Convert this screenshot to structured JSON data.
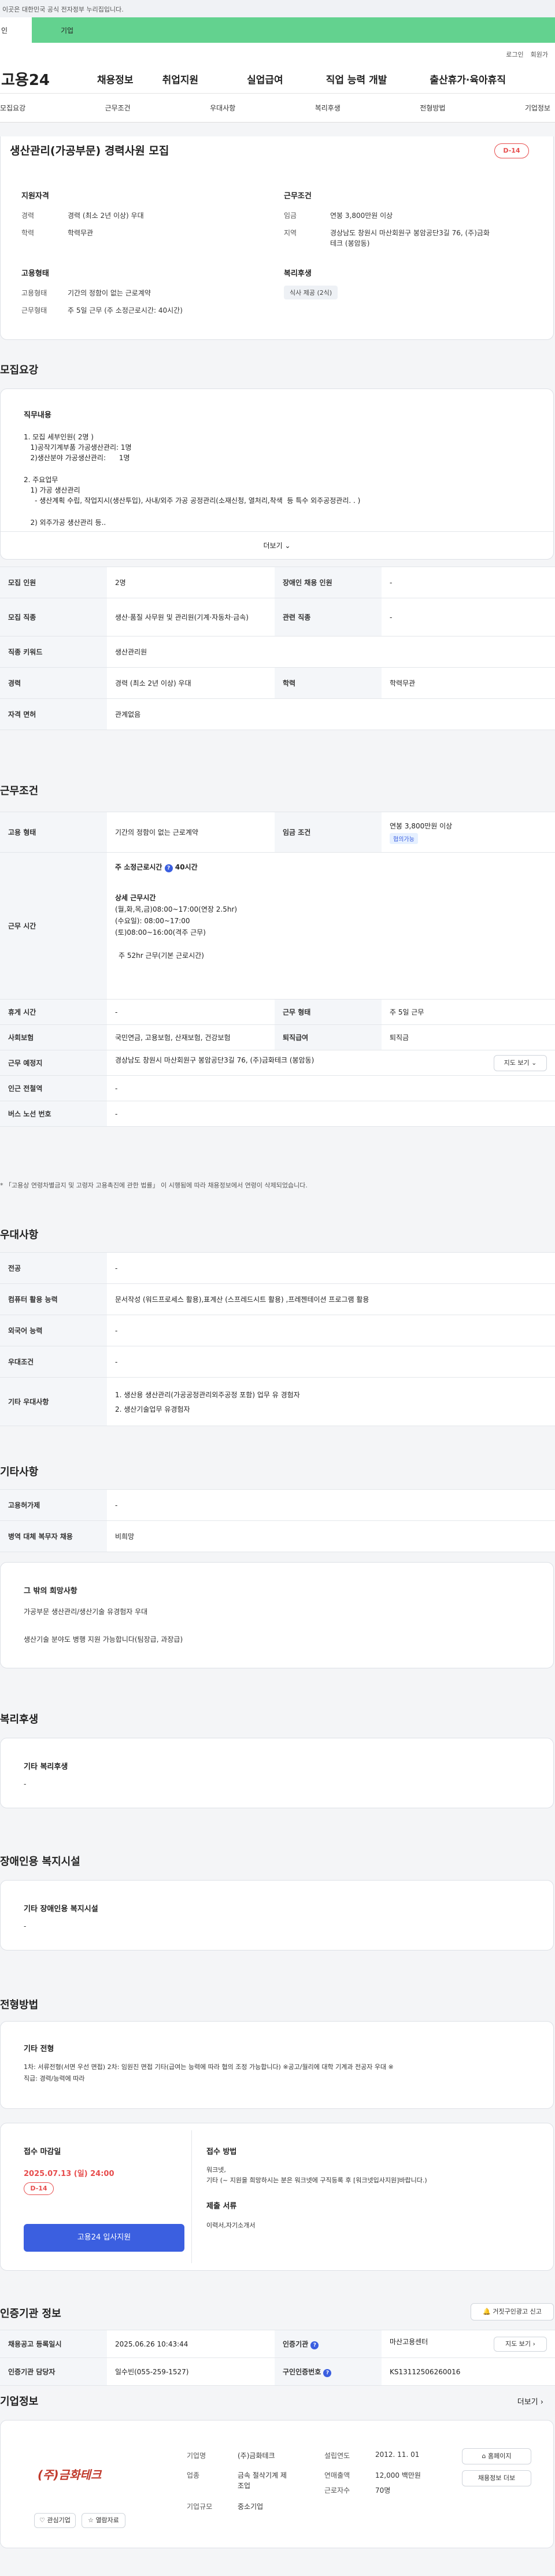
{
  "gov_banner": "이 누리집은 대한민국 공식 전자정부 누리집입니다.",
  "gov_banner_visible": "이곳은 대한민국 공식 전자정부 누리집입니다.",
  "top_tabs": [
    "인",
    "기업"
  ],
  "util": [
    "로그인",
    "회원가"
  ],
  "logo": "고용24",
  "gnb": [
    "채용정보",
    "취업지원",
    "실업급여",
    "직업 능력 개발",
    "출산휴가·육아휴직"
  ],
  "subnav": [
    "모집요강",
    "근무조건",
    "우대사항",
    "복리후생",
    "전형방법",
    "기업정보"
  ],
  "job": {
    "title": "생산관리(가공부문) 경력사원 모집",
    "dday": "D-14",
    "qual_title": "지원자격",
    "career_l": "경력",
    "career_v": "경력 (최소 2년 이상) 우대",
    "edu_l": "학력",
    "edu_v": "학력무관",
    "cond_title": "근무조건",
    "wage_l": "임금",
    "wage_v": "연봉 3,800만원 이상",
    "loc_l": "지역",
    "loc_v1": "경상남도 창원시 마산회원구 봉암공단3길 76, (주)금화",
    "loc_v2": "테크 (봉암동)",
    "emp_title": "고용형태",
    "emp_l": "고용형태",
    "emp_v": "기간의 정함이 없는 근로계약",
    "work_l": "근무형태",
    "work_v": "주 5일 근무 (주 소정근로시간: 40시간)",
    "welfare_title": "복리후생",
    "welfare_tag": "식사 제공 (2식)"
  },
  "recruit": {
    "section": "모집요강",
    "content_title": "직무내용",
    "lines": [
      "1. 모집 세부인원( 2명 )",
      "   1)공작기계부품 가공생산관리: 1명",
      "   2)생산분야 가공생산관리:      1명",
      "",
      "2. 주요업무",
      "   1) 가공 생산관리",
      "     - 생산계획 수립, 작업지시(생산투입), 사내/외주 가공 공정관리(소재신청, 열처리,착색  등 특수 외주공정관리. . )",
      "",
      "   2) 외주가공 생산관리 등.."
    ],
    "more": "더보기",
    "rows": [
      {
        "h1": "모집 인원",
        "v1": "2명",
        "h2": "장애인 채용 인원",
        "v2": "-"
      },
      {
        "h1": "모집 직종",
        "v1": "생산·품질 사무원 및 관리원(기계·자동차·금속)",
        "h2": "관련 직종",
        "v2": "-"
      },
      {
        "h1": "직종 키워드",
        "v1": "생산관리원"
      },
      {
        "h1": "경력",
        "v1": "경력 (최소 2년 이상) 우대",
        "h2": "학력",
        "v2": "학력무관"
      },
      {
        "h1": "자격 면허",
        "v1": "관계없음"
      }
    ]
  },
  "workcond": {
    "section": "근무조건",
    "emp_h": "고용 형태",
    "emp_v": "기간의 정함이 없는 근로계약",
    "wage_h": "임금 조건",
    "wage_v": "연봉 3,800만원 이상",
    "wage_tag": "협의가능",
    "time_h": "근무 시간",
    "time_lines": [
      "주 소정근로시간",
      "40시간",
      "상세 근무시간",
      "(월,화,목,금)08:00~17:00(연장 2.5hr)",
      "(수요일): 08:00~17:00",
      "(토)08:00~16:00(격주 근무)",
      "주 52hr 근무(기본 근로시간)"
    ],
    "rest_h": "휴게 시간",
    "rest_v": "-",
    "workday_h": "근무 형태",
    "workday_v": "주 5일 근무",
    "ins_h": "사회보험",
    "ins_v": "국민연금, 고용보험, 산재보험, 건강보험",
    "retire_h": "퇴직급여",
    "retire_v": "퇴직금",
    "addr_h": "근무 예정지",
    "addr_v": "경상남도 창원시 마산회원구 봉암공단3길 76, (주)금화테크 (봉암동)",
    "map_btn": "지도 보기",
    "station_h": "인근 전철역",
    "station_v": "-",
    "bus_h": "버스 노선 번호",
    "bus_v": "-",
    "note": "* 「고용상 연령차별금지 및 고령자 고용촉진에 관한 법률」 이 시행됨에 따라 채용정보에서 연령이 삭제되었습니다."
  },
  "pref": {
    "section": "우대사항",
    "rows": [
      {
        "h": "전공",
        "v": "-"
      },
      {
        "h": "컴퓨터 활용 능력",
        "v": "문서작성 (워드프로세스 활용),표계산 (스프레드시트 활용) ,프레젠테이션 프로그램 활용"
      },
      {
        "h": "외국어 능력",
        "v": "-"
      },
      {
        "h": "우대조건",
        "v": "-"
      },
      {
        "h": "기타 우대사항",
        "v1": "1. 생산용 생산관리(가공공정관리외주공정 포함) 업무 유 경험자",
        "v2": "2. 생산기술업무 유경험자"
      }
    ]
  },
  "etc": {
    "section": "기타사항",
    "rows": [
      {
        "h": "고용허가제",
        "v": "-"
      },
      {
        "h": "병역 대체 복무자 채용",
        "v": "비희망"
      }
    ],
    "box_title": "그 밖의 희망사항",
    "box_lines": [
      "가공부문 생산관리/생산기술 유경험자 우대",
      "",
      "생산기술 분야도 병행 지원 가능합니다(팀장급, 과장급)"
    ]
  },
  "welfare": {
    "section": "복리후생",
    "title": "기타 복리후생",
    "value": "-"
  },
  "disability": {
    "section": "장애인용 복지시설",
    "title": "기타 장애인용 복지시설",
    "value": "-"
  },
  "process": {
    "section": "전형방법",
    "title": "기타 전형",
    "lines": [
      "1차: 서류전형(서면 우선 면접) 2차: 임원진 면접 기타(급여는 능력에 따라 협의 조정 가능합니다) ※공고/월리에 대학 기계과 전공자 우대 ※",
      "직급: 경력/능력에 따라"
    ],
    "deadline_title": "접수 마감일",
    "deadline": "2025.07.13 (일) 24:00",
    "dday": "D-14",
    "apply_btn": "고용24 입사지원",
    "method_title": "접수 방법",
    "method_lines": [
      "워크넷,",
      "기타 (~  지원을 희망하시는 분은 워크넷에 구직등록 후 [워크넷입사지원]바랍니다.)"
    ],
    "docs_title": "제출 서류",
    "docs": "이력서,자기소개서"
  },
  "agency": {
    "section": "인증기관 정보",
    "report_btn": "거짓구인광고 신고",
    "reg_h": "채용공고 등록일시",
    "reg_v": "2025.06.26 10:43:44",
    "agency_h": "인증기관",
    "agency_v": "마산고용센터",
    "map_btn": "지도 보기",
    "mgr_h": "인증기관 담당자",
    "mgr_v": "일수빈(055-259-1527)",
    "no_h": "구인인증번호",
    "no_v": "KS13112506260016"
  },
  "company": {
    "section": "기업정보",
    "more": "더보기",
    "logo_text": "(주)금화테크",
    "fav_btn": "관심기업",
    "follow_btn": "열람자료",
    "name_l": "기업명",
    "name_v": "(주)금화테크",
    "ind_l": "업종",
    "ind_v1": "금속 절삭기계 제",
    "ind_v2": "조업",
    "size_l": "기업규모",
    "size_v": "중소기업",
    "est_l": "설립연도",
    "est_v": "2012. 11. 01",
    "sales_l": "연매출액",
    "sales_v": "12,000 백만원",
    "emp_l": "근로자수",
    "emp_v": "70명",
    "home_btn": "홈페이지",
    "jobs_btn": "채용정보 더보"
  },
  "colors": {
    "accent": "#3b5fe0",
    "brand_green": "#63d28f",
    "danger": "#e74c4c"
  },
  "icons": [
    "chevron-down-icon",
    "info-icon",
    "map-icon",
    "bell-icon",
    "heart-icon",
    "star-icon",
    "home-icon"
  ]
}
